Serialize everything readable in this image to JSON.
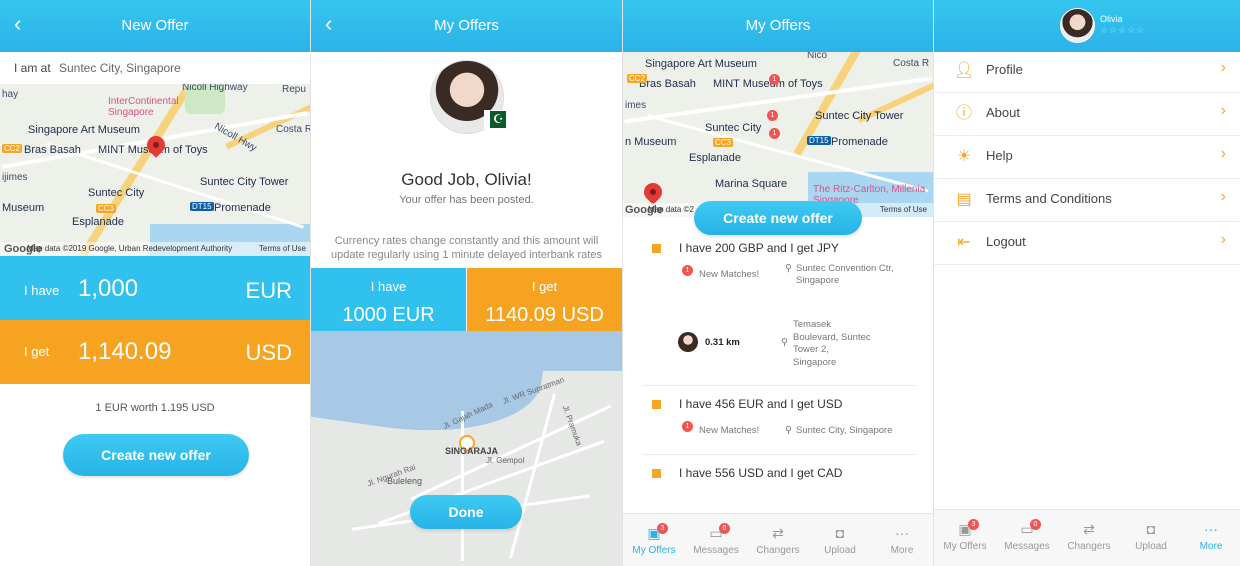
{
  "screen1": {
    "title": "New Offer",
    "location_label": "I am at",
    "location_value": "Suntec City, Singapore",
    "have_label": "I have",
    "have_amount": "1,000",
    "have_currency": "EUR",
    "get_label": "I get",
    "get_amount": "1,140.09",
    "get_currency": "USD",
    "rate_text": "1 EUR worth 1.195 USD",
    "create_button": "Create new offer",
    "map": {
      "labels": [
        "hay",
        "InterContinental",
        "Singapore",
        "Singapore Art Museum",
        "Bras Basah",
        "MINT Museum of Toys",
        "Nicoll Hwy",
        "Suntec City",
        "Suntec City Tower",
        "Promenade",
        "Esplanade",
        "Museum",
        "ijimes",
        "Nicoll Highway",
        "Costa R",
        "Repu",
        "CC2",
        "CC3",
        "DT15"
      ],
      "footer": "Map data ©2019 Google, Urban Redevelopment Authority",
      "terms": "Terms of Use"
    }
  },
  "screen2": {
    "title": "My Offers",
    "heading": "Good Job, Olivia!",
    "subheading": "Your offer has been posted.",
    "note": "Currency rates change constantly and this amount will update regularly using 1 minute delayed interbank rates",
    "have_label": "I have",
    "have_value": "1000 EUR",
    "get_label": "I get",
    "get_value": "1140.09 USD",
    "map_city": "SINGARAJA",
    "map_place": "Buleleng",
    "done_button": "Done",
    "map_streets": [
      "Jl. WR Supratman",
      "Jl. Gajah Mada",
      "Jl. Gempol",
      "Jl. Pramuka",
      "Jl. Ngurah Rai"
    ]
  },
  "screen3": {
    "title": "My Offers",
    "create_button": "Create new offer",
    "map": {
      "labels": [
        "Singapore Art Museum",
        "Bras Basah",
        "MINT Museum of Toys",
        "Suntec City",
        "Suntec City Tower",
        "Promenade",
        "Esplanade",
        "Marina Square",
        "The Ritz-Carlton, Millenia Singapore",
        "n Museum",
        "imes",
        "Nico",
        "Costa R",
        "CC2",
        "CC3",
        "DT15"
      ],
      "footer": "Map data ©2",
      "terms": "Terms of Use",
      "marker_counts": [
        "1",
        "1",
        "1"
      ]
    },
    "offers": [
      {
        "text": "I have 200 GBP and I get JPY",
        "matches_count": "1",
        "matches": "New Matches!",
        "location": "Suntec Convention Ctr, Singapore"
      },
      {
        "distance": "0.31 km",
        "location": "Temasek Boulevard, Suntec Tower 2, Singapore"
      },
      {
        "text": "I have 456 EUR and I get USD",
        "matches_count": "1",
        "matches": "New Matches!",
        "location": "Suntec City, Singapore"
      },
      {
        "text": "I have 556 USD and I get CAD"
      }
    ],
    "tabs": [
      {
        "label": "My Offers",
        "icon": "offers-icon",
        "badge": "3"
      },
      {
        "label": "Messages",
        "icon": "messages-icon",
        "badge": "0"
      },
      {
        "label": "Changers",
        "icon": "changers-icon"
      },
      {
        "label": "Upload",
        "icon": "camera-icon"
      },
      {
        "label": "More",
        "icon": "more-icon"
      }
    ]
  },
  "screen4": {
    "user_name": "Olivia",
    "rating": "☆☆☆☆☆",
    "menu": [
      {
        "label": "Profile",
        "icon": "user-icon"
      },
      {
        "label": "About",
        "icon": "info-icon"
      },
      {
        "label": "Help",
        "icon": "bulb-icon"
      },
      {
        "label": "Terms and Conditions",
        "icon": "document-icon"
      },
      {
        "label": "Logout",
        "icon": "logout-icon"
      }
    ],
    "tabs": [
      {
        "label": "My Offers",
        "badge": "3"
      },
      {
        "label": "Messages",
        "badge": "0"
      },
      {
        "label": "Changers"
      },
      {
        "label": "Upload"
      },
      {
        "label": "More"
      }
    ]
  },
  "colors": {
    "primary": "#2cb2e8",
    "accent": "#f5a623",
    "badge": "#e55555"
  }
}
